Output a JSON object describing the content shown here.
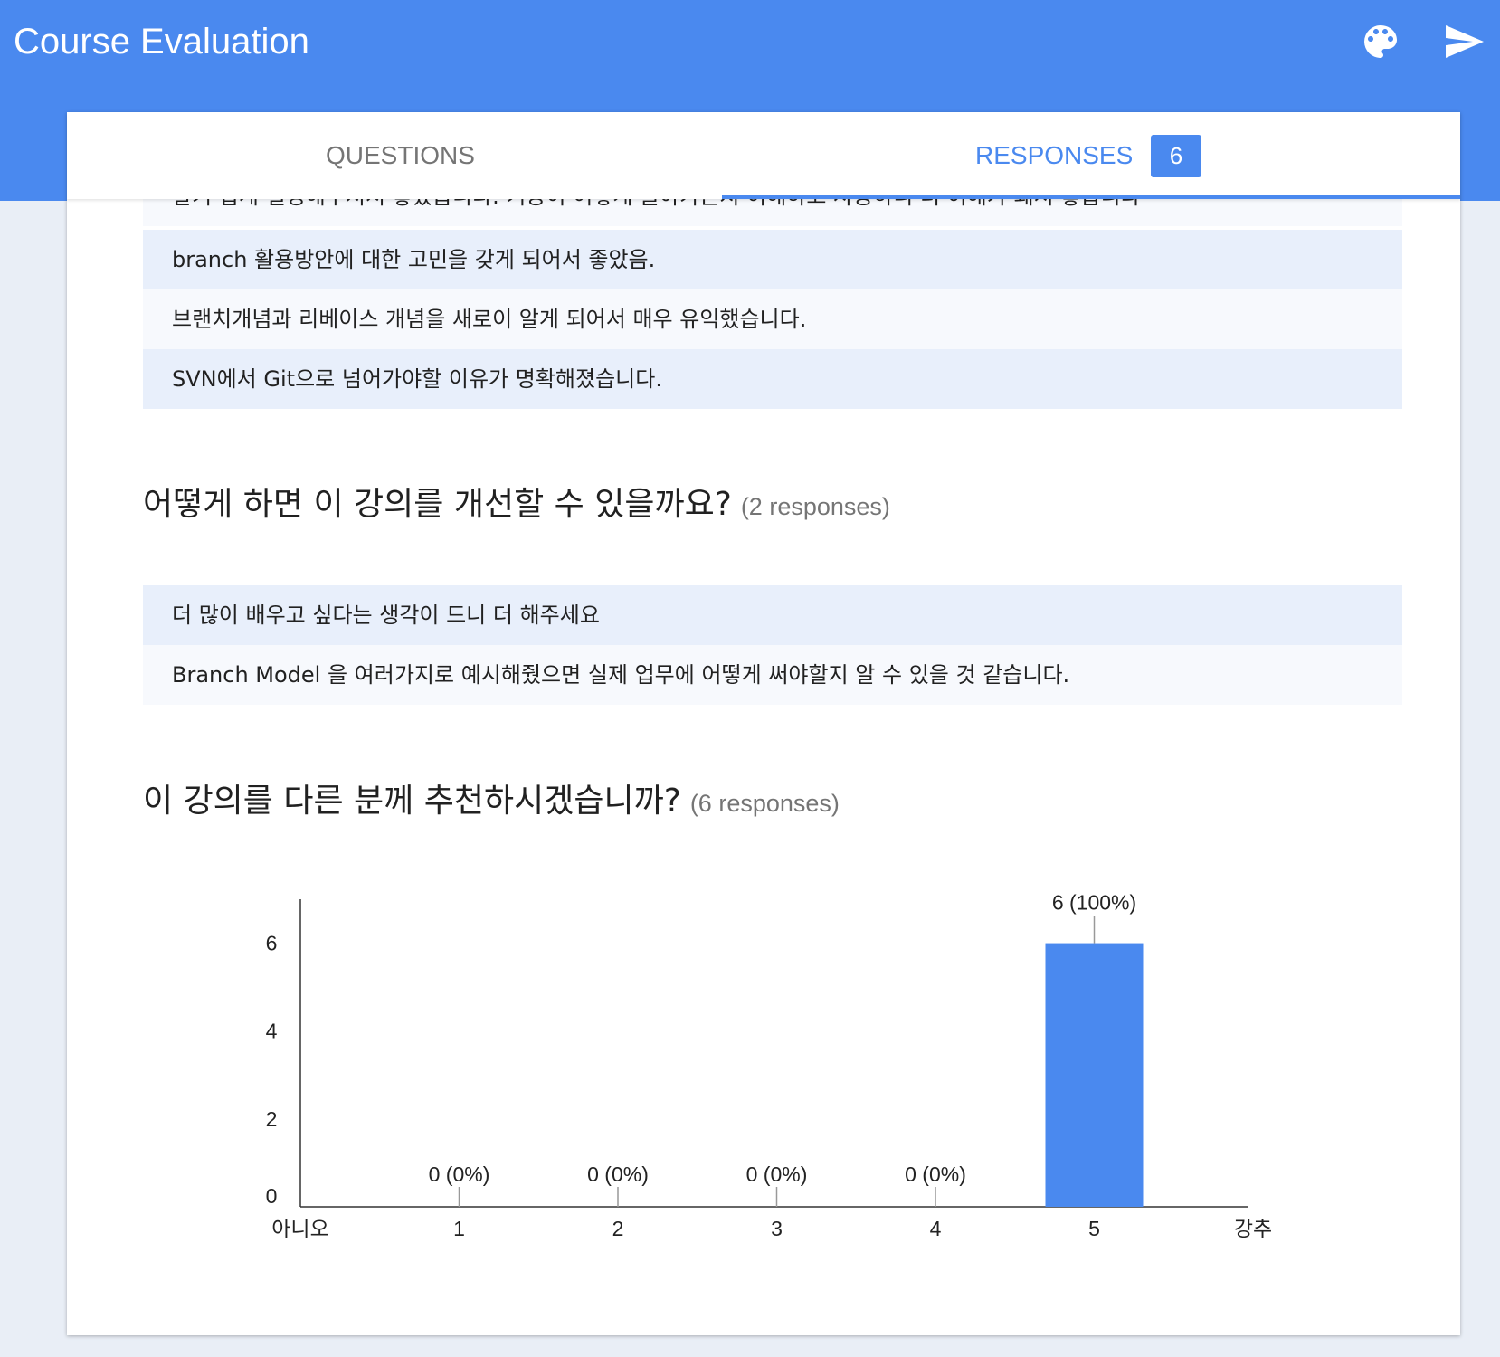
{
  "app": {
    "title": "Course Evaluation",
    "palette_icon": "palette-icon",
    "send_icon": "send-icon",
    "brand_color": "#4a89ef"
  },
  "tabs": {
    "questions_label": "QUESTIONS",
    "responses_label": "RESPONSES",
    "responses_count": "6"
  },
  "partial_row_text": "알기 쉽게 설명해주셔서 좋았습니다. 기능이 어떻게 돌아가는지 이해하고 사용하니 더 이해가 돼서 좋습니다",
  "responses_prev": [
    "branch 활용방안에 대한 고민을 갖게 되어서 좋았음.",
    "브랜치개념과 리베이스 개념을 새로이 알게 되어서 매우 유익했습니다.",
    "SVN에서 Git으로 넘어가야할 이유가 명확해졌습니다."
  ],
  "question_improve": {
    "title": "어떻게 하면 이 강의를 개선할 수 있을까요?",
    "count": "(2 responses)",
    "responses": [
      "더 많이 배우고 싶다는 생각이 드니 더 해주세요",
      "Branch Model 을 여러가지로 예시해줬으면 실제 업무에 어떻게 써야할지 알 수 있을 것 같습니다."
    ]
  },
  "question_recommend": {
    "title": "이 강의를 다른 분께 추천하시겠습니까?",
    "count": "(6 responses)"
  },
  "chart_data": {
    "type": "bar",
    "title": "",
    "xlabel": "",
    "ylabel": "",
    "categories": [
      "1",
      "2",
      "3",
      "4",
      "5"
    ],
    "values": [
      0,
      0,
      0,
      0,
      6
    ],
    "data_labels": [
      "0 (0%)",
      "0 (0%)",
      "0 (0%)",
      "0 (0%)",
      "6 (100%)"
    ],
    "scale_min_label": "아니오",
    "scale_max_label": "강추",
    "y_ticks": [
      0,
      2,
      4,
      6
    ],
    "ylim": [
      0,
      7
    ],
    "grid": false,
    "bar_color": "#4a89ef"
  }
}
